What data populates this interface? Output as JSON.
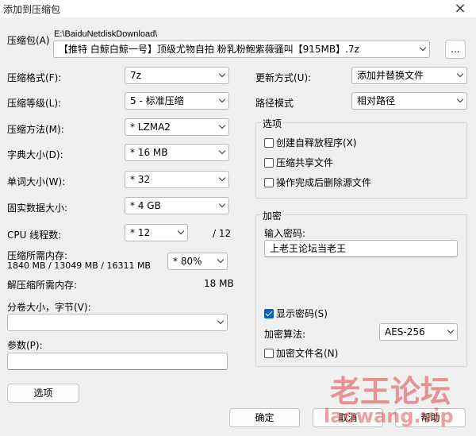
{
  "window": {
    "title": "添加到压缩包",
    "close_glyph": "×"
  },
  "archive": {
    "label": "压缩包(A)",
    "path": "E:\\BaiduNetdiskDownload\\",
    "filename": "【推特 白鲸白鲸一号】顶级尤物自拍 粉乳粉鲍紫薇骚叫【915MB】.7z",
    "browse_label": "..."
  },
  "left": {
    "format": {
      "label": "压缩格式(F):",
      "value": "7z"
    },
    "level": {
      "label": "压缩等级(L):",
      "value": "5 - 标准压缩"
    },
    "method": {
      "label": "压缩方法(M):",
      "value": "* LZMA2"
    },
    "dict": {
      "label": "字典大小(D):",
      "value": "* 16 MB"
    },
    "word": {
      "label": "单词大小(W):",
      "value": "* 32"
    },
    "solid": {
      "label": "固实数据大小:",
      "value": "* 4 GB"
    },
    "cpu": {
      "label": "CPU 线程数:",
      "value": "* 12",
      "total": "/ 12"
    },
    "mem": {
      "label": "压缩所需内存:",
      "detail": "1840 MB / 13049 MB / 16311 MB",
      "value": "* 80%"
    },
    "decomp": {
      "label": "解压缩所需内存:",
      "value": "18 MB"
    },
    "split": {
      "label": "分卷大小，字节(V):",
      "value": ""
    },
    "params": {
      "label": "参数(P):",
      "value": ""
    },
    "options_button": "选项"
  },
  "right": {
    "update": {
      "label": "更新方式(U):",
      "value": "添加并替换文件"
    },
    "pathmode": {
      "label": "路径模式",
      "value": "相对路径"
    },
    "options": {
      "title": "选项",
      "sfx": {
        "label": "创建自释放程序(X)",
        "checked": false
      },
      "shared": {
        "label": "压缩共享文件",
        "checked": false
      },
      "delete": {
        "label": "操作完成后删除源文件",
        "checked": false
      }
    },
    "encryption": {
      "title": "加密",
      "password_label": "输入密码:",
      "password_value": "上老王论坛当老王",
      "show_password": {
        "label": "显示密码(S)",
        "checked": true
      },
      "method": {
        "label": "加密算法:",
        "value": "AES-256"
      },
      "encrypt_names": {
        "label": "加密文件名(N)",
        "checked": false
      }
    }
  },
  "buttons": {
    "ok": "确定",
    "cancel": "取消",
    "help": "帮助"
  },
  "watermark": {
    "title": "老王论坛",
    "url": "laowang.vip"
  }
}
